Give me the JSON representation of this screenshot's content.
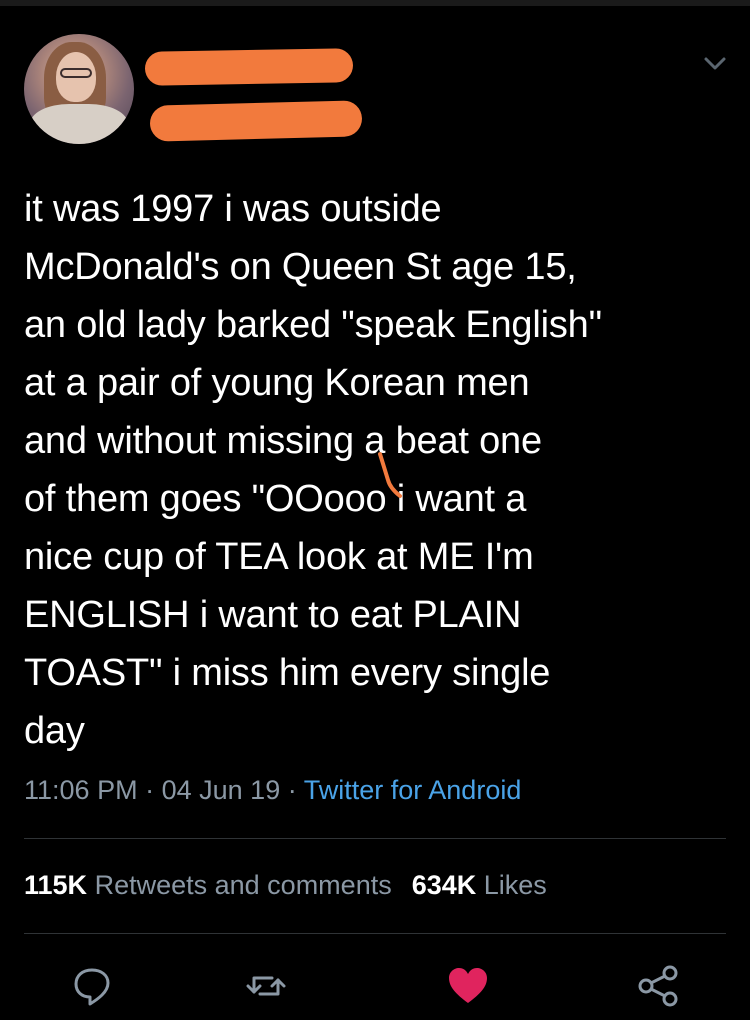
{
  "tweet": {
    "author_avatar": "avatar-photo",
    "text": "it was 1997 i was outside\nMcDonald's on Queen St age 15,\nan old lady barked \"speak English\"\nat a pair of young Korean men\nand without missing a beat one\nof them goes \"OOooo i want a\nnice cup of TEA look at ME I'm\nENGLISH i want to eat PLAIN\nTOAST\" i miss him every single\nday",
    "time": "11:06 PM",
    "separator": "·",
    "date": "04 Jun 19",
    "source": "Twitter for Android"
  },
  "stats": {
    "retweets_count": "115K",
    "retweets_label": "Retweets and comments",
    "likes_count": "634K",
    "likes_label": "Likes"
  },
  "actions": {
    "reply_icon": "reply-icon",
    "retweet_icon": "retweet-icon",
    "like_icon": "heart-icon",
    "share_icon": "share-icon"
  },
  "colors": {
    "background": "#000000",
    "text": "#ffffff",
    "secondary": "#8b98a5",
    "link": "#4aa3e8",
    "like": "#e0245e",
    "redaction": "#f27a3d"
  }
}
